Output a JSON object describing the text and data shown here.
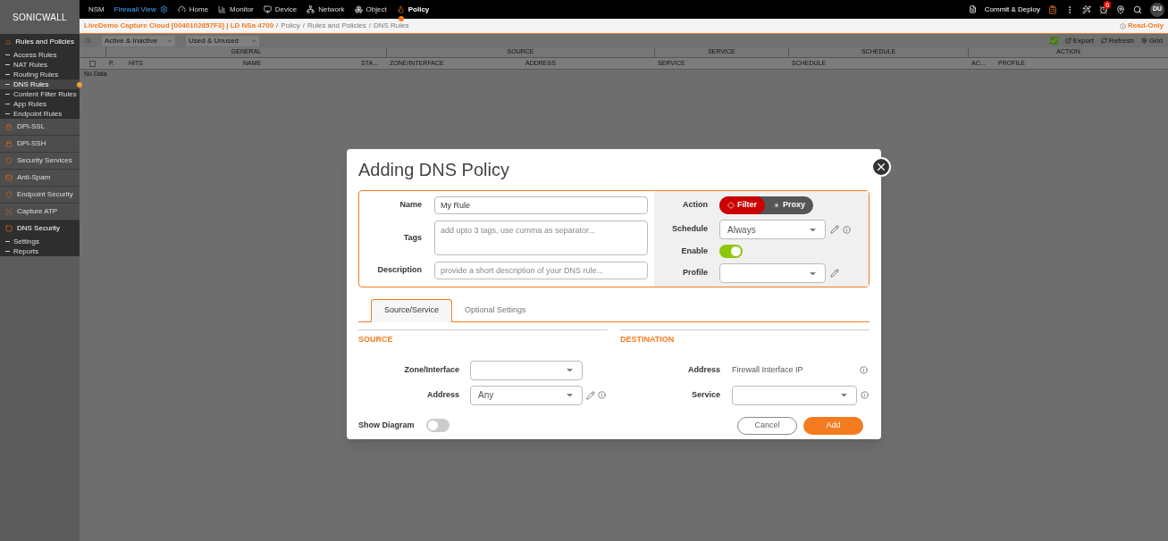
{
  "top_nav": {
    "brand": "SONICWALL",
    "items": [
      {
        "label": "NSM",
        "kind": "text",
        "selected": false
      },
      {
        "label": "Firewall View",
        "kind": "view",
        "selected": false
      },
      {
        "label": "Home",
        "kind": "home",
        "selected": false
      },
      {
        "label": "Monitor",
        "kind": "monitor",
        "selected": false
      },
      {
        "label": "Device",
        "kind": "device",
        "selected": false
      },
      {
        "label": "Network",
        "kind": "network",
        "selected": false
      },
      {
        "label": "Object",
        "kind": "object",
        "selected": false
      },
      {
        "label": "Policy",
        "kind": "policy",
        "selected": true
      }
    ],
    "commit": "Commit & Deploy",
    "alert_count": "6",
    "avatar": "DU"
  },
  "breadcrumb": {
    "separator": "/",
    "items": [
      "LiveDemo Capture Cloud [0040102857F3] | LD NSa 4700",
      "Policy",
      "Rules and Policies",
      "DNS Rules"
    ],
    "status": "Read-Only"
  },
  "sidebar": {
    "sections": [
      {
        "label": "Rules and Policies",
        "expanded": true,
        "children": [
          {
            "label": "Access Rules",
            "selected": false
          },
          {
            "label": "NAT Rules",
            "selected": false
          },
          {
            "label": "Routing Rules",
            "selected": false
          },
          {
            "label": "DNS Rules",
            "selected": true
          },
          {
            "label": "Content Filter Rules",
            "selected": false
          },
          {
            "label": "App Rules",
            "selected": false
          },
          {
            "label": "Endpoint Rules",
            "selected": false
          }
        ]
      },
      {
        "label": "DPI-SSL",
        "expanded": false
      },
      {
        "label": "DPI-SSH",
        "expanded": false
      },
      {
        "label": "Security Services",
        "expanded": false
      },
      {
        "label": "Anti-Spam",
        "expanded": false
      },
      {
        "label": "Endpoint Security",
        "expanded": false
      },
      {
        "label": "Capture ATP",
        "expanded": false
      },
      {
        "label": "DNS Security",
        "expanded": true,
        "children": [
          {
            "label": "Settings",
            "selected": false
          },
          {
            "label": "Reports",
            "selected": false
          }
        ]
      }
    ]
  },
  "toolbar": {
    "filters": [
      "Active & Inactive",
      "Used & Unused"
    ],
    "actions": [
      "Export",
      "Refresh",
      "Grid"
    ]
  },
  "table": {
    "groups": [
      "GENERAL",
      "SOURCE",
      "SERVICE",
      "SCHEDULE",
      "ACTION"
    ],
    "columns": [
      "P.",
      "HITS",
      "NAME",
      "STA...",
      "ZONE/INTERFACE",
      "ADDRESS",
      "SERVICE",
      "SCHEDULE",
      "AC...",
      "PROFILE"
    ],
    "select_all": {
      "checked": false
    },
    "empty": "No Data"
  },
  "dialog": {
    "title": "Adding DNS Policy",
    "name": {
      "label": "Name",
      "value": "My Rule"
    },
    "tags": {
      "label": "Tags",
      "placeholder": "add upto 3 tags, use comma as separator..."
    },
    "description": {
      "label": "Description",
      "placeholder": "provide a short description of your DNS rule..."
    },
    "action": {
      "label": "Action",
      "options": [
        {
          "label": "Filter",
          "selected": true
        },
        {
          "label": "Proxy",
          "selected": false
        }
      ]
    },
    "schedule": {
      "label": "Schedule",
      "value": "Always"
    },
    "enable": {
      "label": "Enable",
      "on": true
    },
    "profile": {
      "label": "Profile"
    },
    "tabs": [
      {
        "label": "Source/Service",
        "selected": true
      },
      {
        "label": "Optional Settings",
        "selected": false
      }
    ],
    "source": {
      "title": "SOURCE",
      "zone": {
        "label": "Zone/Interface"
      },
      "address": {
        "label": "Address",
        "value": "Any"
      }
    },
    "destination": {
      "title": "DESTINATION",
      "address": {
        "label": "Address",
        "value": "Firewall Interface IP"
      },
      "service": {
        "label": "Service"
      }
    },
    "show_diagram": {
      "label": "Show Diagram",
      "on": false
    },
    "buttons": [
      "Cancel",
      "Add"
    ]
  }
}
